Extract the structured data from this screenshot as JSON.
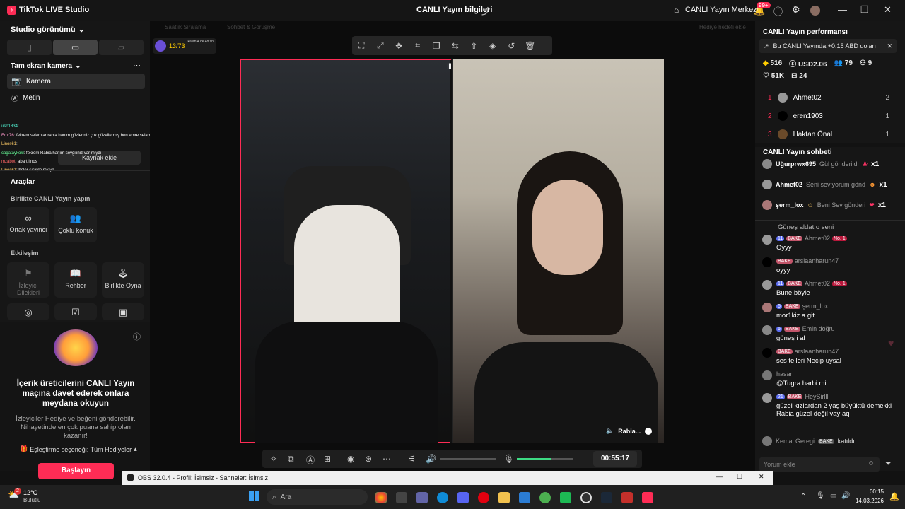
{
  "titlebar": {
    "app_title": "TikTok LIVE Studio",
    "center_title": "CANLI Yayın bilgileri",
    "live_center": "CANLI Yayın Merkezi",
    "notif_badge": "99+",
    "win_min": "—",
    "win_max": "❐",
    "win_close": "✕"
  },
  "left": {
    "studio_view": "Studio görünümü",
    "fullscreen_camera": "Tam ekran kamera",
    "source_camera": "Kamera",
    "source_text": "Metin",
    "add_source": "Kaynak ekle",
    "tools_title": "Araçlar",
    "together_section": "Birlikte CANLI Yayın yapın",
    "tool_cohost": "Ortak yayıncı",
    "tool_multi_guest": "Çoklu konuk",
    "interaction_section": "Etkileşim",
    "tool_viewer_wishes": "İzleyici Dilekleri",
    "tool_guide": "Rehber",
    "tool_play_together": "Birlikte Oyna",
    "promo_title": "İçerik üreticilerini CANLI Yayın maçına davet ederek onlara meydana okuyun",
    "promo_desc": "İzleyiciler Hediye ve beğeni gönderebilir. Nihayetinde en çok puana sahip olan kazanır!",
    "match_option": "Eşleştirme seçeneği: Tüm Hediyeler",
    "start_button": "Başlayın"
  },
  "overlay_comments": [
    {
      "user": "ııso1834",
      "text": ":"
    },
    {
      "user": "Emr76",
      "text": ": fekrem selamlar rabia hanım gözleriniz çok güzellermiş ben emre selam"
    },
    {
      "user": "Linos61",
      "text": ":"
    },
    {
      "user": "cagataykokl",
      "text": ": fekrem Rabia hanım sevgiliniz var mıydı"
    },
    {
      "user": "mzabot",
      "text": ": abart linos"
    },
    {
      "user": "Linos61",
      "text": ": beler sırayla mk ya"
    }
  ],
  "center": {
    "top_left_stat": "13/73",
    "top_left_time": "kalan 4 dk 48 sn",
    "faded_1": "Saatlik Sıralama",
    "faded_2": "Sohbet & Görüşme",
    "faded_right": "Hediye hedefi ekle",
    "guest_name": "Rabia...",
    "timer": "00:55:17",
    "volume_level": 0.6
  },
  "right": {
    "perf_title": "CANLI Yayın performansı",
    "perf_banner": "Bu CANLI Yayında +0.15 ABD doları",
    "stats": [
      {
        "icon": "diamond",
        "value": "516"
      },
      {
        "icon": "dollar",
        "value": "USD2.06"
      },
      {
        "icon": "viewers",
        "value": "79"
      },
      {
        "icon": "new-followers",
        "value": "9"
      },
      {
        "icon": "likes",
        "value": "51K"
      },
      {
        "icon": "gifts",
        "value": "24"
      }
    ],
    "leaderboard": [
      {
        "rank": "1",
        "name": "Ahmet02",
        "count": "2"
      },
      {
        "rank": "2",
        "name": "eren1903",
        "count": "1"
      },
      {
        "rank": "3",
        "name": "Haktan Önal",
        "count": "1"
      }
    ],
    "chat_title": "CANLI Yayın sohbeti",
    "gift_events": [
      {
        "name": "Uğurprwx695",
        "text": "Gül gönderildi",
        "mult": "x1"
      },
      {
        "name": "Ahmet02",
        "text": "Seni seviyorum gönd",
        "mult": "x1"
      },
      {
        "name": "şerm_lox",
        "text": "Beni Sev gönderi",
        "mult": "x1"
      }
    ],
    "chat_cut": "Güneş aldatıo seni",
    "chat": [
      {
        "level": "11",
        "badge": "BAKE",
        "name": "Ahmet02",
        "rank": "No. 1",
        "msg": "Oyyy"
      },
      {
        "level": "",
        "badge": "BAKE",
        "name": "arslaanharun47",
        "rank": "",
        "msg": "oyyy"
      },
      {
        "level": "11",
        "badge": "BAKE",
        "name": "Ahmet02",
        "rank": "No. 1",
        "msg": "Bune böyle"
      },
      {
        "level": "6",
        "badge": "BAKE",
        "name": "şerm_lox",
        "rank": "",
        "msg": "mor1kiz a git"
      },
      {
        "level": "6",
        "badge": "BAKE",
        "name": "Emin doğru",
        "rank": "",
        "msg": "güneş i al"
      },
      {
        "level": "",
        "badge": "BAKE",
        "name": "arslaanharun47",
        "rank": "",
        "msg": "ses telleri Necip uysal"
      },
      {
        "level": "",
        "badge": "",
        "name": "hasan",
        "rank": "",
        "msg": "@Tugra harbi mi"
      },
      {
        "level": "21",
        "badge": "BAKE",
        "name": "HeySirlll",
        "rank": "",
        "msg": "güzel kızlardan 2 yaş büyüktü demekki Rabia güzel değil vay aq"
      }
    ],
    "joined_name": "Kemal Geregi",
    "joined_badge": "BAKE",
    "joined_text": "katıldı",
    "comment_placeholder": "Yorum ekle"
  },
  "obs": {
    "title": "OBS 32.0.4 - Profil: İsimsiz - Sahneler: İsimsiz"
  },
  "taskbar": {
    "weather_temp": "12°C",
    "weather_desc": "Bulutlu",
    "weather_badge": "2",
    "search_placeholder": "Ara",
    "time": "00:15",
    "date": "14.03.2026"
  },
  "colors": {
    "accent": "#fe2c55",
    "volume_green": "#3ddc84"
  }
}
